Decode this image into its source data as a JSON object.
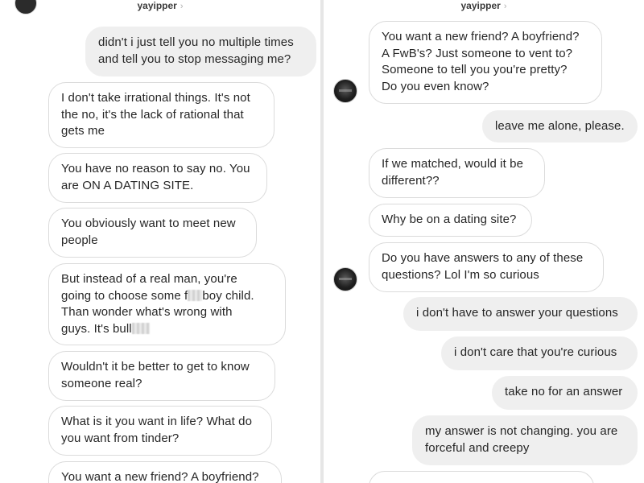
{
  "conversation": {
    "username": "yayipper",
    "chevron": "›"
  },
  "left": {
    "messages": [
      {
        "sender": "me",
        "text": "didn't i just tell you no multiple times\nand tell you to stop messaging me?"
      },
      {
        "sender": "them",
        "text": "I don't take irrational things. It's not\nthe no, it's the lack of rational that\ngets me"
      },
      {
        "sender": "them",
        "text": "You have no reason to say no. You\nare ON A DATING SITE."
      },
      {
        "sender": "them",
        "text": "You obviously want to meet new\npeople"
      },
      {
        "sender": "them",
        "text_parts": [
          "But instead of a real man, you're\ngoing to choose some f",
          "boy child.\nThan wonder what's wrong with\nguys. It's bull",
          ""
        ]
      },
      {
        "sender": "them",
        "text": "Wouldn't it be better to get to know\nsomeone real?"
      },
      {
        "sender": "them",
        "text": "What is it you want in life? What do\nyou want from tinder?"
      },
      {
        "sender": "them",
        "text": "You want a new friend? A boyfriend?"
      }
    ]
  },
  "right": {
    "messages": [
      {
        "sender": "them",
        "text": "You want a new friend? A boyfriend?\nA FwB's? Just someone to vent to?\nSomeone to tell you you're pretty?\nDo you even know?"
      },
      {
        "sender": "me",
        "text": "leave me alone, please."
      },
      {
        "sender": "them",
        "text": "If we matched, would it be\ndifferent??"
      },
      {
        "sender": "them",
        "text": "Why be on a dating site?"
      },
      {
        "sender": "them",
        "text": "Do you have answers to any of these\nquestions? Lol I'm so curious"
      },
      {
        "sender": "me",
        "text": "i don't have to answer your questions"
      },
      {
        "sender": "me",
        "text": "i don't care that you're curious"
      },
      {
        "sender": "me",
        "text": "take no for an answer"
      },
      {
        "sender": "me",
        "text": "my answer is not changing. you are\nforceful and creepy"
      }
    ]
  },
  "colors": {
    "incoming_bubble": "#ffffff",
    "incoming_border": "#dbdbdb",
    "outgoing_bubble": "#efefef",
    "text": "#262626",
    "divider": "#e6e6e6"
  },
  "icons": {
    "censor": "blur-censor-icon",
    "avatar": "profile-avatar"
  }
}
